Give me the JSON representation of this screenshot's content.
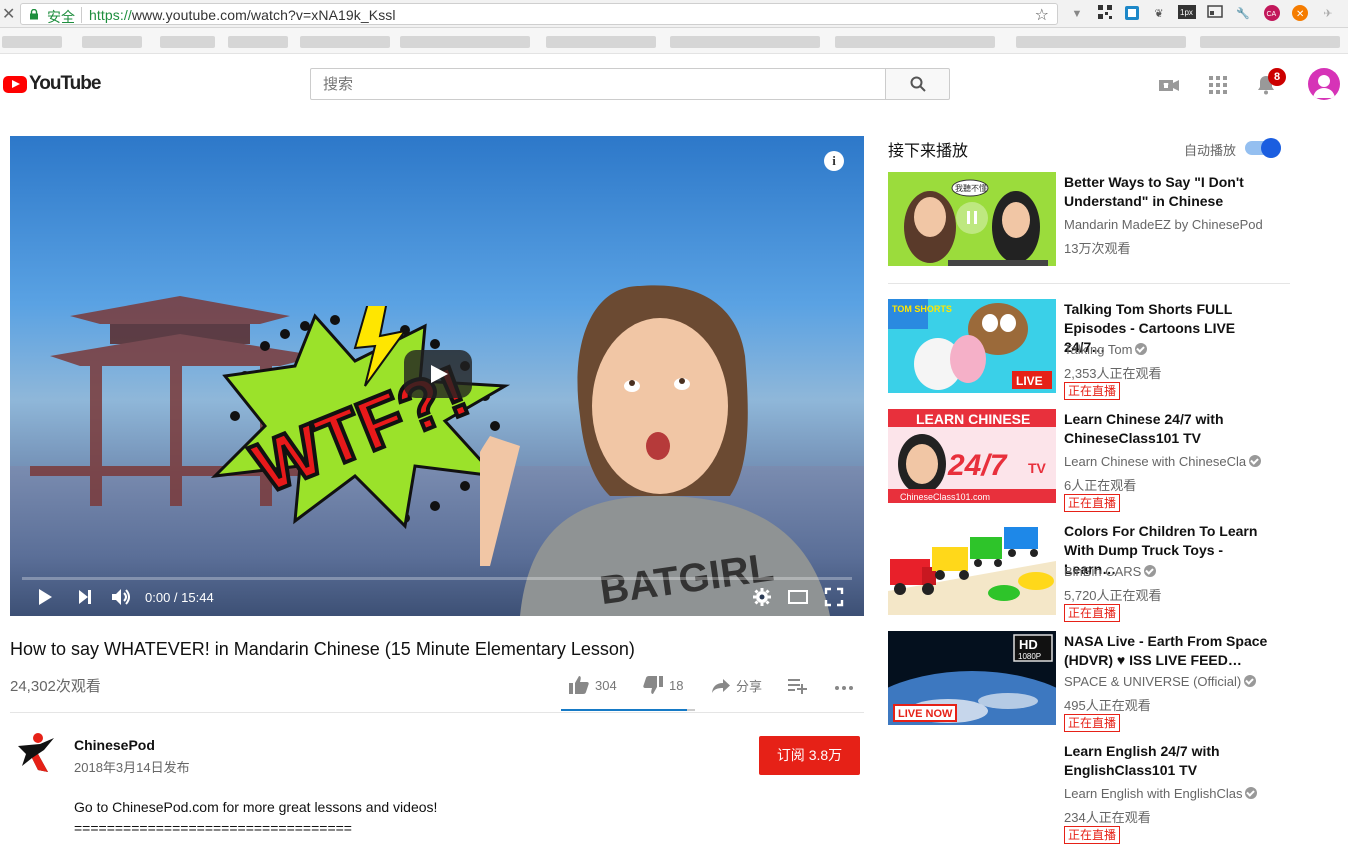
{
  "browser": {
    "secure_label": "安全",
    "url_scheme": "https://",
    "url_rest": "www.youtube.com/watch?v=xNA19k_Kssl"
  },
  "header": {
    "logo_text": "YouTube",
    "search_placeholder": "搜索",
    "notification_count": "8"
  },
  "player": {
    "time": "0:00 / 15:44",
    "thumbnail_text": "WTF?!",
    "shirt_text": "BATGIRL"
  },
  "video": {
    "title": "How to say WHATEVER! in Mandarin Chinese (15 Minute Elementary Lesson)",
    "views": "24,302次观看",
    "likes": "304",
    "dislikes": "18",
    "share_label": "分享",
    "like_ratio": 0.944
  },
  "channel": {
    "name": "ChinesePod",
    "published": "2018年3月14日发布",
    "subscribe_label": "订阅 3.8万"
  },
  "description": {
    "line1": "Go to ChinesePod.com for more great lessons and videos!",
    "line2": "=================================="
  },
  "sidebar": {
    "up_next": "接下来播放",
    "autoplay": "自动播放",
    "recommendations": [
      {
        "title": "Better Ways to Say \"I Don't Understand\" in Chinese",
        "channel": "Mandarin MadeEZ by ChinesePod",
        "meta": "13万次观看",
        "thumb_text": "我聽不懂",
        "verified": false,
        "live": ""
      },
      {
        "title": "Talking Tom Shorts FULL Episodes - Cartoons LIVE 24/7…",
        "channel": "Talking Tom",
        "meta": "2,353人正在观看",
        "thumb_text": "TOM SHORTS",
        "thumb_live": "LIVE",
        "verified": true,
        "live": "正在直播"
      },
      {
        "title": "Learn Chinese 24/7 with ChineseClass101 TV",
        "channel": "Learn Chinese with ChineseCla",
        "meta": "6人正在观看",
        "thumb_text": "LEARN CHINESE",
        "thumb_big": "24/7",
        "thumb_tv": "TV",
        "thumb_site": "ChineseClass101.com",
        "verified": true,
        "live": "正在直播"
      },
      {
        "title": "Colors For Children To Learn With Dump Truck Toys - Learn…",
        "channel": "BinBin CARS",
        "meta": "5,720人正在观看",
        "verified": true,
        "live": "正在直播"
      },
      {
        "title": "NASA Live - Earth From Space (HDVR) ♥ ISS LIVE FEED…",
        "channel": "SPACE & UNIVERSE (Official)",
        "meta": "495人正在观看",
        "thumb_hd": "HD",
        "thumb_res": "1080P",
        "thumb_live": "LIVE NOW",
        "verified": true,
        "live": "正在直播"
      },
      {
        "title": "Learn English 24/7 with EnglishClass101 TV",
        "channel": "Learn English with EnglishClas",
        "meta": "234人正在观看",
        "verified": true,
        "live": "正在直播"
      }
    ]
  },
  "colors": {
    "brand_red": "#ff0000",
    "subscribe_red": "#e62117",
    "like_blue": "#167ac6",
    "autoplay_blue": "#1b5ee0"
  }
}
